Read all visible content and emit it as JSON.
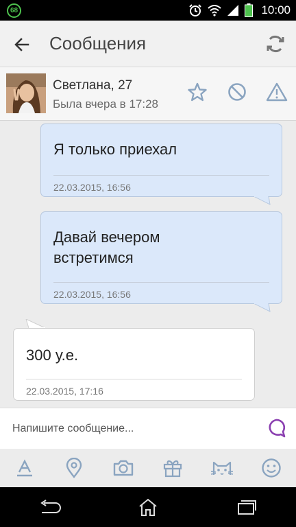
{
  "status_bar": {
    "notification_count": "68",
    "time": "10:00"
  },
  "header": {
    "title": "Сообщения"
  },
  "profile": {
    "name": "Светлана, 27",
    "status": "Была вчера в 17:28"
  },
  "messages": [
    {
      "direction": "out",
      "text": "Я только приехал",
      "timestamp": "22.03.2015, 16:56"
    },
    {
      "direction": "out",
      "text": "Давай вечером встретимся",
      "timestamp": "22.03.2015, 16:56"
    },
    {
      "direction": "in",
      "text": "300 у.е.",
      "timestamp": "22.03.2015, 17:16"
    }
  ],
  "composer": {
    "placeholder": "Напишите сообщение..."
  },
  "toolbar_icons": [
    "text-format-icon",
    "location-icon",
    "camera-icon",
    "gift-icon",
    "cat-sticker-icon",
    "smiley-icon"
  ],
  "colors": {
    "accent": "#8a3fb0",
    "icon_blue": "#8aa4c0",
    "bubble_out": "#dbe8fa",
    "bubble_in": "#ffffff"
  }
}
